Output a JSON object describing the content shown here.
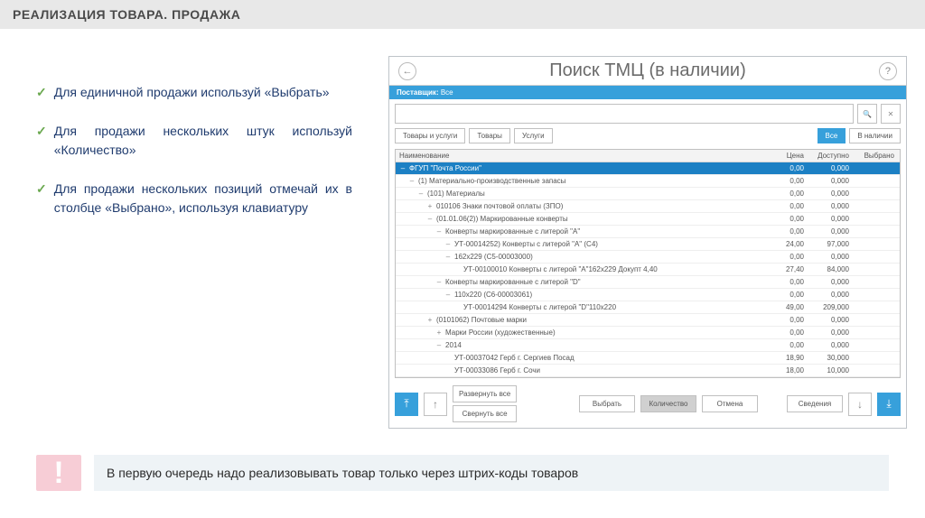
{
  "slide_title": "РЕАЛИЗАЦИЯ ТОВАРА. ПРОДАЖА",
  "bullets": [
    "Для единичной продажи используй «Выбрать»",
    "Для продажи нескольких штук используй «Количество»",
    "Для продажи нескольких позиций отмечай их в столбце «Выбрано», используя клавиатуру"
  ],
  "app": {
    "title": "Поиск ТМЦ (в наличии)",
    "supplier_label": "Поставщик:",
    "supplier_value": "Все",
    "filters": {
      "tab_goods_services": "Товары и услуги",
      "tab_goods": "Товары",
      "tab_services": "Услуги",
      "btn_all": "Все",
      "btn_instock": "В наличии"
    },
    "columns": {
      "name": "Наименование",
      "price": "Цена",
      "available": "Доступно",
      "selected": "Выбрано"
    },
    "rows": [
      {
        "ind": 0,
        "exp": "–",
        "sel": true,
        "name": "ФГУП \"Почта России\"",
        "price": "0,00",
        "avail": "0,000",
        "pick": ""
      },
      {
        "ind": 1,
        "exp": "–",
        "name": "(1) Материально-производственные запасы",
        "price": "0,00",
        "avail": "0,000"
      },
      {
        "ind": 2,
        "exp": "–",
        "name": "(101) Материалы",
        "price": "0,00",
        "avail": "0,000"
      },
      {
        "ind": 3,
        "exp": "+",
        "name": "010106 Знаки почтовой оплаты (ЗПО)",
        "price": "0,00",
        "avail": "0,000"
      },
      {
        "ind": 3,
        "exp": "–",
        "name": "(01.01.06(2)) Маркированные конверты",
        "price": "0,00",
        "avail": "0,000"
      },
      {
        "ind": 4,
        "exp": "–",
        "name": "Конверты маркированные с литерой \"A\"",
        "price": "0,00",
        "avail": "0,000"
      },
      {
        "ind": 5,
        "exp": "–",
        "name": "УТ-00014252) Конверты с литерой \"A\" (C4)",
        "price": "24,00",
        "avail": "97,000"
      },
      {
        "ind": 5,
        "exp": "–",
        "name": "162x229 (C5-00003000)",
        "price": "0,00",
        "avail": "0,000"
      },
      {
        "ind": 6,
        "exp": "",
        "name": "УТ-00100010 Конверты с литерой \"A\"162x229 Докупт 4,40",
        "price": "27,40",
        "avail": "84,000"
      },
      {
        "ind": 4,
        "exp": "–",
        "name": "Конверты маркированные с литерой \"D\"",
        "price": "0,00",
        "avail": "0,000"
      },
      {
        "ind": 5,
        "exp": "–",
        "name": "110x220 (C6-00003061)",
        "price": "0,00",
        "avail": "0,000"
      },
      {
        "ind": 6,
        "exp": "",
        "name": "УТ-00014294 Конверты с литерой \"D\"110x220",
        "price": "49,00",
        "avail": "209,000"
      },
      {
        "ind": 3,
        "exp": "+",
        "name": "(0101062) Почтовые марки",
        "price": "0,00",
        "avail": "0,000"
      },
      {
        "ind": 4,
        "exp": "+",
        "name": "Марки России (художественные)",
        "price": "0,00",
        "avail": "0,000"
      },
      {
        "ind": 4,
        "exp": "–",
        "name": "2014",
        "price": "0,00",
        "avail": "0,000"
      },
      {
        "ind": 5,
        "exp": "",
        "name": "УТ-00037042 Герб г. Сергиев Посад",
        "price": "18,90",
        "avail": "30,000"
      },
      {
        "ind": 5,
        "exp": "",
        "name": "УТ-00033086 Герб г. Сочи",
        "price": "18,00",
        "avail": "10,000"
      }
    ],
    "footer": {
      "expand_all": "Развернуть все",
      "collapse_all": "Свернуть все",
      "select": "Выбрать",
      "quantity": "Количество",
      "cancel": "Отмена",
      "details": "Сведения"
    }
  },
  "note": {
    "mark": "!",
    "text": "В первую очередь надо реализовывать товар  только через штрих-коды товаров"
  }
}
